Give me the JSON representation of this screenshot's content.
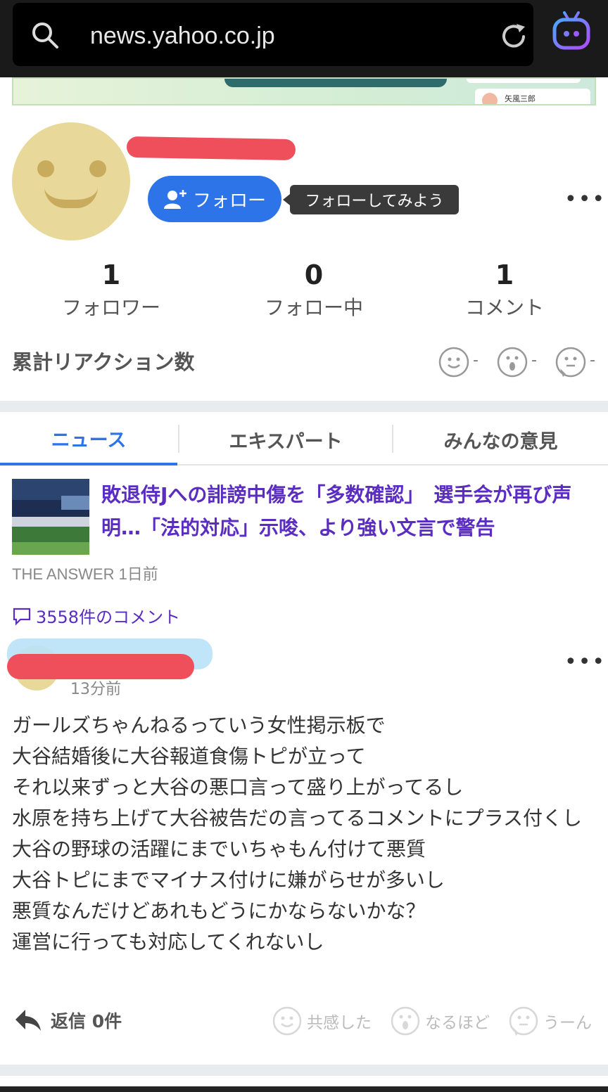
{
  "browser": {
    "url": "news.yahoo.co.jp"
  },
  "banner": {
    "mini_name": "矢風三郎"
  },
  "profile": {
    "follow_label": "フォロー",
    "tooltip": "フォローしてみよう",
    "stats": [
      {
        "num": "1",
        "label": "フォロワー"
      },
      {
        "num": "0",
        "label": "フォロー中"
      },
      {
        "num": "1",
        "label": "コメント"
      }
    ],
    "reaction_title": "累計リアクション数",
    "reaction_counts": [
      "-",
      "-",
      "-"
    ]
  },
  "tabs": [
    {
      "label": "ニュース",
      "active": true
    },
    {
      "label": "エキスパート",
      "active": false
    },
    {
      "label": "みんなの意見",
      "active": false
    }
  ],
  "article": {
    "headline": "敗退侍Jへの誹謗中傷を「多数確認」　選手会が再び声明…「法的対応」示唆、より強い文言で警告",
    "source": "THE ANSWER 1日前",
    "comment_count": "3558件のコメント"
  },
  "comment": {
    "time": "13分前",
    "body": "ガールズちゃんねるっていう女性掲示板で\n大谷結婚後に大谷報道食傷トピが立って\nそれ以来ずっと大谷の悪口言って盛り上がってるし\n水原を持ち上げて大谷被告だの言ってるコメントにプラス付くし\n大谷の野球の活躍にまでいちゃもん付けて悪質\n大谷トピにまでマイナス付けに嫌がらせが多いし\n悪質なんだけどあれもどうにかならないかな？\n運営に行っても対応してくれないし",
    "reply_label": "返信 0件",
    "reactions": [
      "共感した",
      "なるほど",
      "うーん"
    ]
  },
  "colors": {
    "accent": "#2d74e8",
    "headline": "#5b2cc2",
    "redaction": "#ef4f5a"
  }
}
